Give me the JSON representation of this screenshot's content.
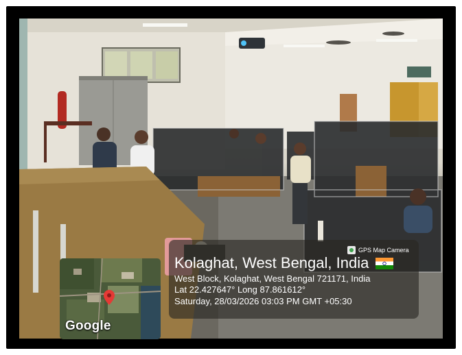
{
  "overlay": {
    "title": "Kolaghat, West Bengal, India",
    "address": "West Block, Kolaghat, West Bengal 721171, India",
    "coordinates": "Lat 22.427647° Long 87.861612°",
    "datetime": "Saturday, 28/03/2026 03:03 PM GMT +05:30",
    "app_badge": "GPS Map Camera",
    "flag_icon": "india-flag-icon"
  },
  "map": {
    "logo": "Google",
    "pin_icon": "map-pin-icon",
    "pin_color": "#e53935"
  },
  "colors": {
    "frame": "#000000",
    "overlay_bg": "#28261e"
  }
}
